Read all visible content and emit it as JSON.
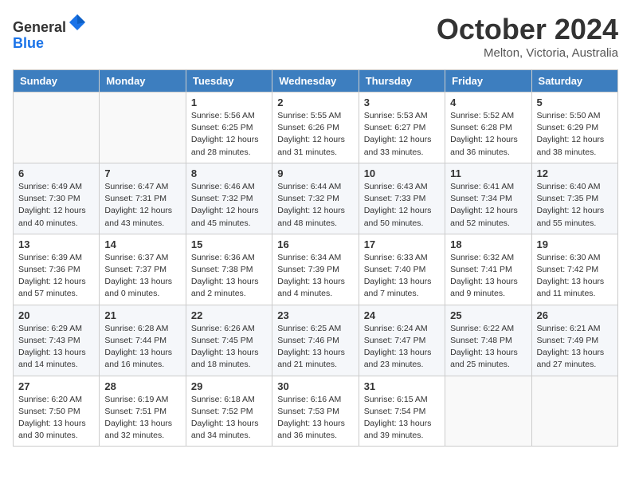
{
  "header": {
    "logo_line1": "General",
    "logo_line2": "Blue",
    "month_title": "October 2024",
    "location": "Melton, Victoria, Australia"
  },
  "days_of_week": [
    "Sunday",
    "Monday",
    "Tuesday",
    "Wednesday",
    "Thursday",
    "Friday",
    "Saturday"
  ],
  "weeks": [
    [
      {
        "day": "",
        "info": ""
      },
      {
        "day": "",
        "info": ""
      },
      {
        "day": "1",
        "info": "Sunrise: 5:56 AM\nSunset: 6:25 PM\nDaylight: 12 hours and 28 minutes."
      },
      {
        "day": "2",
        "info": "Sunrise: 5:55 AM\nSunset: 6:26 PM\nDaylight: 12 hours and 31 minutes."
      },
      {
        "day": "3",
        "info": "Sunrise: 5:53 AM\nSunset: 6:27 PM\nDaylight: 12 hours and 33 minutes."
      },
      {
        "day": "4",
        "info": "Sunrise: 5:52 AM\nSunset: 6:28 PM\nDaylight: 12 hours and 36 minutes."
      },
      {
        "day": "5",
        "info": "Sunrise: 5:50 AM\nSunset: 6:29 PM\nDaylight: 12 hours and 38 minutes."
      }
    ],
    [
      {
        "day": "6",
        "info": "Sunrise: 6:49 AM\nSunset: 7:30 PM\nDaylight: 12 hours and 40 minutes."
      },
      {
        "day": "7",
        "info": "Sunrise: 6:47 AM\nSunset: 7:31 PM\nDaylight: 12 hours and 43 minutes."
      },
      {
        "day": "8",
        "info": "Sunrise: 6:46 AM\nSunset: 7:32 PM\nDaylight: 12 hours and 45 minutes."
      },
      {
        "day": "9",
        "info": "Sunrise: 6:44 AM\nSunset: 7:32 PM\nDaylight: 12 hours and 48 minutes."
      },
      {
        "day": "10",
        "info": "Sunrise: 6:43 AM\nSunset: 7:33 PM\nDaylight: 12 hours and 50 minutes."
      },
      {
        "day": "11",
        "info": "Sunrise: 6:41 AM\nSunset: 7:34 PM\nDaylight: 12 hours and 52 minutes."
      },
      {
        "day": "12",
        "info": "Sunrise: 6:40 AM\nSunset: 7:35 PM\nDaylight: 12 hours and 55 minutes."
      }
    ],
    [
      {
        "day": "13",
        "info": "Sunrise: 6:39 AM\nSunset: 7:36 PM\nDaylight: 12 hours and 57 minutes."
      },
      {
        "day": "14",
        "info": "Sunrise: 6:37 AM\nSunset: 7:37 PM\nDaylight: 13 hours and 0 minutes."
      },
      {
        "day": "15",
        "info": "Sunrise: 6:36 AM\nSunset: 7:38 PM\nDaylight: 13 hours and 2 minutes."
      },
      {
        "day": "16",
        "info": "Sunrise: 6:34 AM\nSunset: 7:39 PM\nDaylight: 13 hours and 4 minutes."
      },
      {
        "day": "17",
        "info": "Sunrise: 6:33 AM\nSunset: 7:40 PM\nDaylight: 13 hours and 7 minutes."
      },
      {
        "day": "18",
        "info": "Sunrise: 6:32 AM\nSunset: 7:41 PM\nDaylight: 13 hours and 9 minutes."
      },
      {
        "day": "19",
        "info": "Sunrise: 6:30 AM\nSunset: 7:42 PM\nDaylight: 13 hours and 11 minutes."
      }
    ],
    [
      {
        "day": "20",
        "info": "Sunrise: 6:29 AM\nSunset: 7:43 PM\nDaylight: 13 hours and 14 minutes."
      },
      {
        "day": "21",
        "info": "Sunrise: 6:28 AM\nSunset: 7:44 PM\nDaylight: 13 hours and 16 minutes."
      },
      {
        "day": "22",
        "info": "Sunrise: 6:26 AM\nSunset: 7:45 PM\nDaylight: 13 hours and 18 minutes."
      },
      {
        "day": "23",
        "info": "Sunrise: 6:25 AM\nSunset: 7:46 PM\nDaylight: 13 hours and 21 minutes."
      },
      {
        "day": "24",
        "info": "Sunrise: 6:24 AM\nSunset: 7:47 PM\nDaylight: 13 hours and 23 minutes."
      },
      {
        "day": "25",
        "info": "Sunrise: 6:22 AM\nSunset: 7:48 PM\nDaylight: 13 hours and 25 minutes."
      },
      {
        "day": "26",
        "info": "Sunrise: 6:21 AM\nSunset: 7:49 PM\nDaylight: 13 hours and 27 minutes."
      }
    ],
    [
      {
        "day": "27",
        "info": "Sunrise: 6:20 AM\nSunset: 7:50 PM\nDaylight: 13 hours and 30 minutes."
      },
      {
        "day": "28",
        "info": "Sunrise: 6:19 AM\nSunset: 7:51 PM\nDaylight: 13 hours and 32 minutes."
      },
      {
        "day": "29",
        "info": "Sunrise: 6:18 AM\nSunset: 7:52 PM\nDaylight: 13 hours and 34 minutes."
      },
      {
        "day": "30",
        "info": "Sunrise: 6:16 AM\nSunset: 7:53 PM\nDaylight: 13 hours and 36 minutes."
      },
      {
        "day": "31",
        "info": "Sunrise: 6:15 AM\nSunset: 7:54 PM\nDaylight: 13 hours and 39 minutes."
      },
      {
        "day": "",
        "info": ""
      },
      {
        "day": "",
        "info": ""
      }
    ]
  ]
}
